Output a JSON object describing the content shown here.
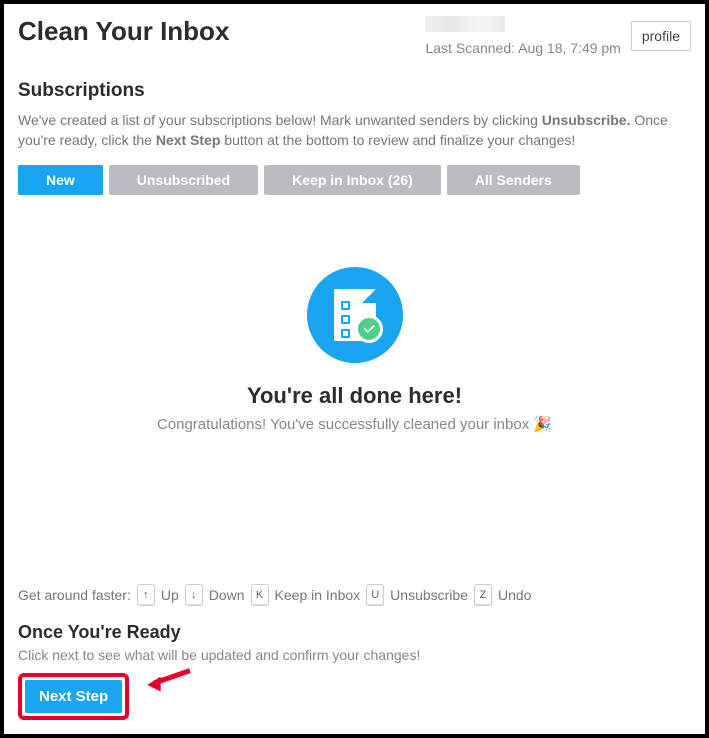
{
  "header": {
    "title": "Clean Your Inbox",
    "last_scanned": "Last Scanned: Aug 18, 7:49 pm",
    "profile_label": "profile"
  },
  "subs": {
    "heading": "Subscriptions",
    "intro_a": "We've created a list of your subscriptions below! Mark unwanted senders by clicking ",
    "intro_b": "Unsubscribe.",
    "intro_c": " Once you're ready, click the ",
    "intro_d": "Next Step",
    "intro_e": " button at the bottom to review and finalize your changes!"
  },
  "tabs": {
    "new": "New",
    "unsub": "Unsubscribed",
    "keep": "Keep in Inbox (26)",
    "all": "All Senders"
  },
  "done": {
    "title": "You're all done here!",
    "subtitle": "Congratulations! You've successfully cleaned your inbox 🎉"
  },
  "hotkeys": {
    "lead": "Get around faster:",
    "k_up": "↑",
    "l_up": "Up",
    "k_down": "↓",
    "l_down": "Down",
    "k_keep": "K",
    "l_keep": "Keep in Inbox",
    "k_unsub": "U",
    "l_unsub": "Unsubscribe",
    "k_undo": "Z",
    "l_undo": "Undo"
  },
  "ready": {
    "heading": "Once You're Ready",
    "sub": "Click next to see what will be updated and confirm your changes!",
    "button": "Next Step"
  }
}
